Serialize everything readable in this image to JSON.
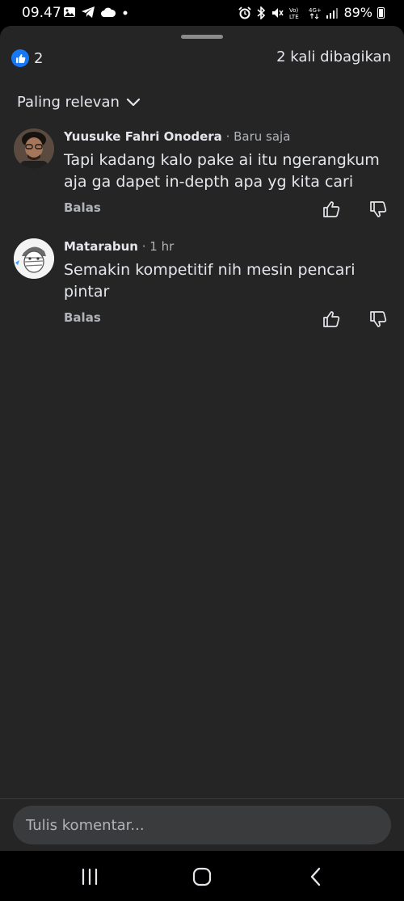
{
  "status_bar": {
    "time": "09.47",
    "battery": "89%",
    "left_icons": [
      "gallery-icon",
      "telegram-icon",
      "cloud-icon",
      "dot-icon"
    ],
    "right_icons": [
      "alarm-icon",
      "bluetooth-icon",
      "mute-icon",
      "volte-icon",
      "4g-icon",
      "signal-icon",
      "battery-icon"
    ]
  },
  "summary": {
    "reaction_count": "2",
    "shares": "2 kali dibagikan"
  },
  "sort": {
    "label": "Paling relevan"
  },
  "comments": [
    {
      "name": "Yuusuke Fahri Onodera",
      "time": " · Baru saja",
      "text": "Tapi kadang kalo pake ai itu ngerangkum aja ga dapet in-depth apa yg kita cari",
      "reply": "Balas"
    },
    {
      "name": "Matarabun",
      "time": " · 1 hr",
      "text": "Semakin kompetitif nih mesin pencari pintar",
      "reply": "Balas"
    }
  ],
  "composer": {
    "placeholder": "Tulis komentar..."
  },
  "colors": {
    "sheet_bg": "#252526",
    "like_blue": "#1877f2",
    "input_bg": "#3a3b3c",
    "secondary_text": "#b0b3b8"
  }
}
